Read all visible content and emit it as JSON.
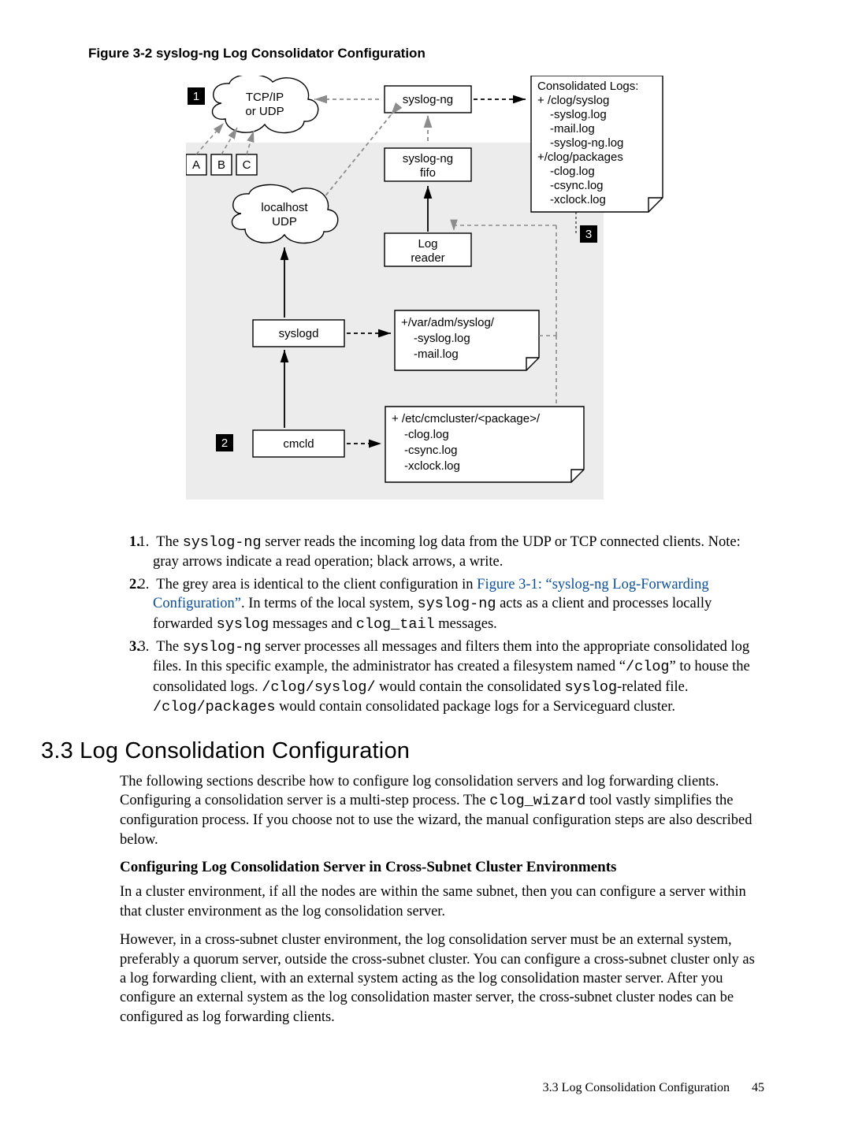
{
  "figure_caption": "Figure 3-2 syslog-ng Log Consolidator Configuration",
  "diagram": {
    "num1": "1",
    "num2": "2",
    "num3": "3",
    "boxA": "A",
    "boxB": "B",
    "boxC": "C",
    "cloud1_line1": "TCP/IP",
    "cloud1_line2": "or UDP",
    "cloud2_line1": "localhost",
    "cloud2_line2": "UDP",
    "syslogng": "syslog-ng",
    "syslogng_fifo_line1": "syslog-ng",
    "syslogng_fifo_line2": "fifo",
    "log_reader_line1": "Log",
    "log_reader_line2": "reader",
    "syslogd": "syslogd",
    "cmcld": "cmcld",
    "consolidated_title": "Consolidated Logs:",
    "consolidated_l1": "+ /clog/syslog",
    "consolidated_l2": "-syslog.log",
    "consolidated_l3": "-mail.log",
    "consolidated_l4": "-syslog-ng.log",
    "consolidated_l5": "+/clog/packages",
    "consolidated_l6": "-clog.log",
    "consolidated_l7": "-csync.log",
    "consolidated_l8": "-xclock.log",
    "var_adm_l1": "+/var/adm/syslog/",
    "var_adm_l2": "-syslog.log",
    "var_adm_l3": "-mail.log",
    "etc_cm_l1": "+ /etc/cmcluster/<package>/",
    "etc_cm_l2": "-clog.log",
    "etc_cm_l3": "-csync.log",
    "etc_cm_l4": "-xclock.log"
  },
  "list": {
    "item1_a": "The ",
    "item1_code1": "syslog-ng",
    "item1_b": " server reads the incoming log data from the UDP or TCP connected clients. Note: gray arrows indicate a read operation; black arrows, a write.",
    "item2_a": "The grey area is identical to the client configuration in ",
    "item2_link": "Figure 3-1: “syslog-ng Log-Forwarding Configuration”",
    "item2_b": ". In terms of the local system, ",
    "item2_code1": "syslog-ng",
    "item2_c": " acts as a client and processes locally forwarded ",
    "item2_code2": "syslog",
    "item2_d": " messages and ",
    "item2_code3": "clog_tail",
    "item2_e": " messages.",
    "item3_a": "The ",
    "item3_code1": "syslog-ng",
    "item3_b": " server processes all messages and filters them into the appropriate consolidated log files. In this specific example, the administrator has created a filesystem named “",
    "item3_code2": "/clog",
    "item3_c": "” to house the consolidated logs. ",
    "item3_code3": "/clog/syslog/",
    "item3_d": " would contain the consolidated ",
    "item3_code4": "syslog",
    "item3_e": "-related file. ",
    "item3_code5": "/clog/packages",
    "item3_f": " would contain consolidated package logs for a Serviceguard cluster."
  },
  "section_title": "3.3 Log Consolidation Configuration",
  "para1_a": "The following sections describe how to configure log consolidation servers and log forwarding clients. Configuring a consolidation server is a multi-step process. The ",
  "para1_code": "clog_wizard",
  "para1_b": " tool vastly simplifies the configuration process. If you choose not to use the wizard, the manual configuration steps are also described below.",
  "subhead": "Configuring Log Consolidation Server in Cross-Subnet Cluster Environments",
  "para2": "In a cluster environment, if all the nodes are within the same subnet, then you can configure a server within that cluster environment as the log consolidation server.",
  "para3": "However, in a cross-subnet cluster environment, the log consolidation server must be an external system, preferably a quorum server, outside the cross-subnet cluster. You can configure a cross-subnet cluster only as a log forwarding client, with an external system acting as the log consolidation master server. After you configure an external system as the log consolidation master server, the cross-subnet cluster nodes can be configured as log forwarding clients.",
  "footer_text": "3.3 Log Consolidation Configuration",
  "footer_page": "45"
}
